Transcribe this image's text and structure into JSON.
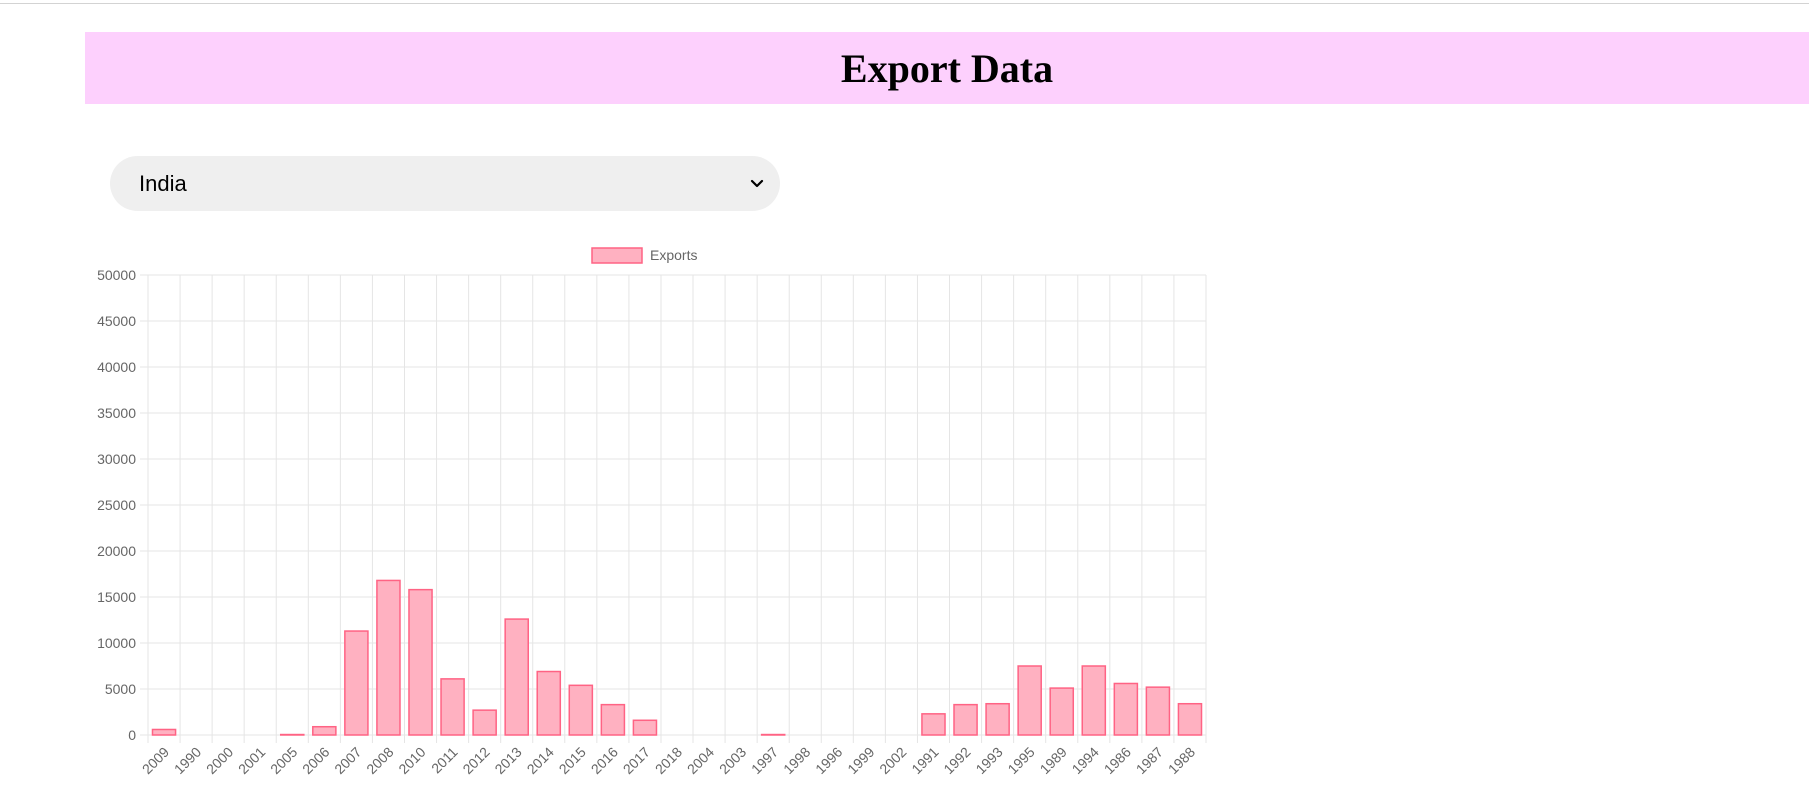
{
  "header": {
    "title": "Export Data"
  },
  "country_select": {
    "selected": "India"
  },
  "chart_data": {
    "type": "bar",
    "categories": [
      "2009",
      "1990",
      "2000",
      "2001",
      "2005",
      "2006",
      "2007",
      "2008",
      "2010",
      "2011",
      "2012",
      "2013",
      "2014",
      "2015",
      "2016",
      "2017",
      "2018",
      "2004",
      "2003",
      "1997",
      "1998",
      "1996",
      "1999",
      "2002",
      "1991",
      "1992",
      "1993",
      "1995",
      "1989",
      "1994",
      "1986",
      "1987",
      "1988"
    ],
    "series": [
      {
        "name": "Exports",
        "values": [
          600,
          0,
          0,
          0,
          50,
          900,
          11300,
          16800,
          15800,
          6100,
          2700,
          12600,
          6900,
          5400,
          3300,
          1600,
          0,
          0,
          0,
          50,
          0,
          0,
          0,
          0,
          2300,
          3300,
          3400,
          7500,
          5100,
          7500,
          5600,
          5200,
          3400
        ]
      }
    ],
    "ylim": [
      0,
      50000
    ],
    "yticks": [
      50000,
      45000,
      40000,
      35000,
      30000,
      25000,
      20000,
      15000,
      10000,
      5000,
      0
    ],
    "grid": true,
    "legend_position": "top",
    "colors": {
      "bar_fill": "#ffb1c1",
      "bar_stroke": "#ff6384",
      "grid": "#e5e5e5",
      "tick_text": "#666666"
    }
  }
}
